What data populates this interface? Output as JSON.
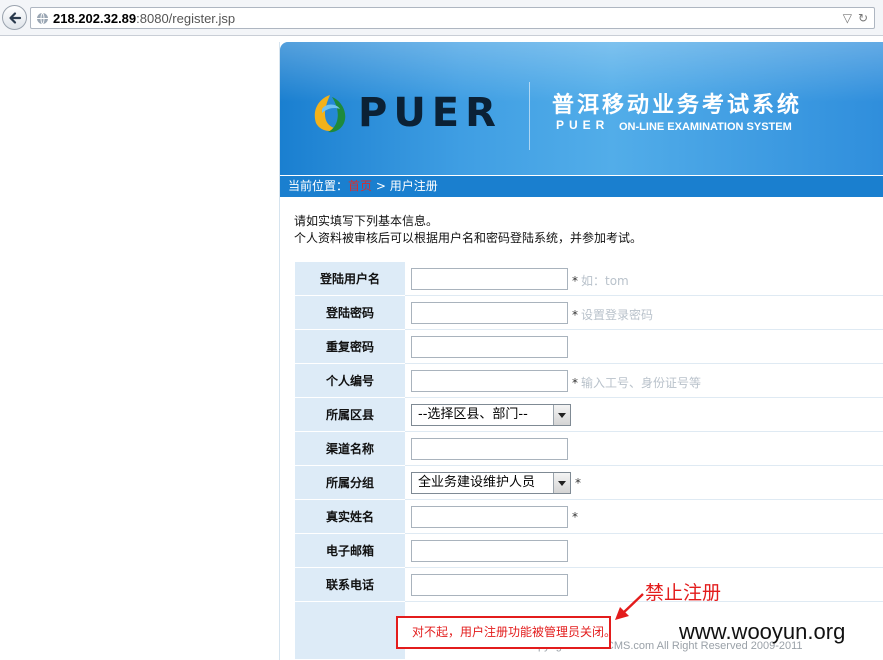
{
  "browser": {
    "url_host": "218.202.32.89",
    "url_path": ":8080/register.jsp"
  },
  "banner": {
    "logo_text": "PUER",
    "title": "普洱移动业务考试系统",
    "subtitle_a": "PUER",
    "subtitle_b": "ON-LINE EXAMINATION SYSTEM"
  },
  "breadcrumb": {
    "prefix": "当前位置：",
    "home": "首页",
    "separator": " > ",
    "current": "用户注册"
  },
  "intro": {
    "line1": "请如实填写下列基本信息。",
    "line2": "个人资料被审核后可以根据用户名和密码登陆系统，并参加考试。"
  },
  "form": {
    "rows": [
      {
        "label": "登陆用户名",
        "required": "*",
        "hint": "如：tom"
      },
      {
        "label": "登陆密码",
        "required": "*",
        "hint": "设置登录密码"
      },
      {
        "label": "重复密码"
      },
      {
        "label": "个人编号",
        "required": "*",
        "hint": "输入工号、身份证号等"
      },
      {
        "label": "所属区县",
        "select": "--选择区县、部门--"
      },
      {
        "label": "渠道名称"
      },
      {
        "label": "所属分组",
        "select": "全业务建设维护人员",
        "required": "*"
      },
      {
        "label": "真实姓名",
        "required": "*"
      },
      {
        "label": "电子邮箱"
      },
      {
        "label": "联系电话"
      }
    ]
  },
  "error_message": "对不起，用户注册功能被管理员关闭。",
  "copyright": "Copyright © TomCMS.com All Right Reserved 2009-2011",
  "annotation": "禁止注册",
  "watermark": "www.wooyun.org",
  "colors": {
    "accent": "#1a7fcf",
    "error": "#e31c1c",
    "label_bg": "#ddebf7"
  }
}
